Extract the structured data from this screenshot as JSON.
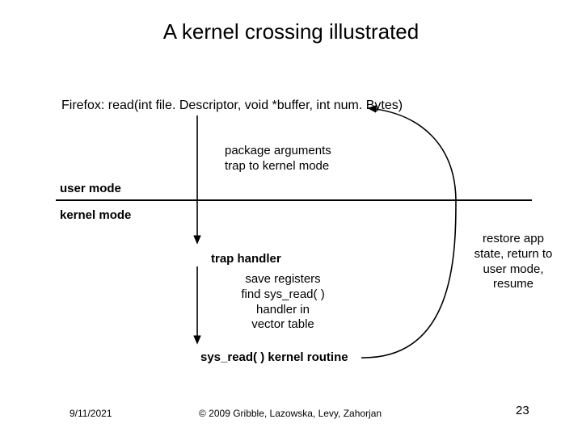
{
  "title": "A kernel crossing illustrated",
  "firefox_call": "Firefox: read(int file. Descriptor, void *buffer, int num. Bytes)",
  "pkg_args_line1": "package arguments",
  "pkg_args_line2": "trap to kernel mode",
  "user_mode": "user mode",
  "kernel_mode": "kernel mode",
  "trap_handler": "trap handler",
  "save_regs_line1": "save registers",
  "save_regs_line2": "find sys_read( )",
  "save_regs_line3": "handler in",
  "save_regs_line4": "vector table",
  "sys_read_routine": "sys_read( ) kernel routine",
  "restore_line1": "restore app",
  "restore_line2": "state, return to",
  "restore_line3": "user mode,",
  "restore_line4": "resume",
  "footer": {
    "date": "9/11/2021",
    "copyright": "© 2009 Gribble, Lazowska, Levy, Zahorjan",
    "page": "23"
  },
  "colors": {
    "black": "#000000"
  }
}
